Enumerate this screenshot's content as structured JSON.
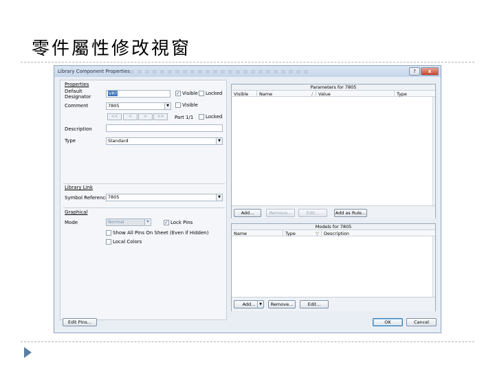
{
  "slide": {
    "title": "零件屬性修改視窗"
  },
  "dialog": {
    "title": "Library Component Properties",
    "help_label": "?",
    "close_label": "x",
    "properties": {
      "group_label": "Properties",
      "designator_label_line1": "Default",
      "designator_label_line2": "Designator",
      "designator_value": "VR?",
      "designator_visible_label": "Visible",
      "designator_visible_checked": true,
      "designator_locked_label": "Locked",
      "designator_locked_checked": false,
      "comment_label": "Comment",
      "comment_value": "7805",
      "comment_visible_label": "Visible",
      "comment_visible_checked": false,
      "nav_first": "<<",
      "nav_prev": "<",
      "nav_next": ">",
      "nav_last": ">>",
      "part_label": "Part 1/1",
      "part_locked_label": "Locked",
      "part_locked_checked": false,
      "description_label": "Description",
      "description_value": "",
      "type_label": "Type",
      "type_value": "Standard"
    },
    "library_link": {
      "group_label": "Library Link",
      "symbol_reference_label": "Symbol Reference",
      "symbol_reference_value": "7805"
    },
    "graphical": {
      "group_label": "Graphical",
      "mode_label": "Mode",
      "mode_value": "Normal",
      "lock_pins_label": "Lock Pins",
      "lock_pins_checked": true,
      "show_all_pins_label": "Show All Pins On Sheet (Even if Hidden)",
      "show_all_pins_checked": false,
      "local_colors_label": "Local Colors",
      "local_colors_checked": false
    },
    "parameters": {
      "caption": "Parameters for 7805",
      "columns": [
        "Visible",
        "Name",
        "/",
        "Value",
        "Type"
      ],
      "rows": [],
      "add_label": "Add...",
      "remove_label": "Remove...",
      "edit_label": "Edit...",
      "add_rule_label": "Add as Rule..."
    },
    "models": {
      "caption": "Models for 7805",
      "columns": [
        "Name",
        "Type",
        "▽",
        "Description"
      ],
      "rows": [],
      "add_label": "Add...",
      "remove_label": "Remove...",
      "edit_label": "Edit..."
    },
    "footer": {
      "edit_pins_label": "Edit Pins...",
      "ok_label": "OK",
      "cancel_label": "Cancel"
    }
  }
}
